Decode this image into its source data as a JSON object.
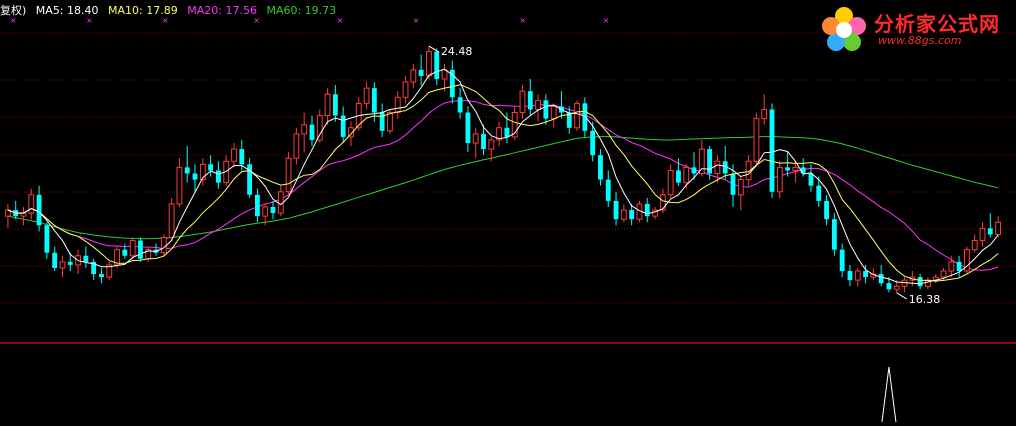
{
  "legend": {
    "prefix": "复权)",
    "ma5": "MA5: 18.40",
    "ma10": "MA10: 17.89",
    "ma20": "MA20: 17.56",
    "ma60": "MA60: 19.73"
  },
  "logo": {
    "title": "分析家公式网",
    "url": "www.88gs.com"
  },
  "colors": {
    "background": "#000000",
    "up": "#ff3b3b",
    "down": "#00ffff",
    "ma5": "#ffffff",
    "ma10": "#ffff66",
    "ma20": "#ff33ff",
    "ma60": "#33cc33",
    "grid": "#8b0000",
    "separator": "#ff2020"
  },
  "chart_data": {
    "type": "candlestick",
    "title": "",
    "price_axis": {
      "min": 15.0,
      "max": 25.5
    },
    "annotations": [
      {
        "label": "24.48",
        "type": "high",
        "index": 54
      },
      {
        "label": "16.38",
        "type": "low",
        "index": 114
      }
    ],
    "candles": [
      [
        18.9,
        19.3,
        18.5,
        19.1
      ],
      [
        19.1,
        19.4,
        18.8,
        18.9
      ],
      [
        18.9,
        19.2,
        18.6,
        19.0
      ],
      [
        19.0,
        19.8,
        18.8,
        19.6
      ],
      [
        19.6,
        19.9,
        18.4,
        18.6
      ],
      [
        18.6,
        18.7,
        17.5,
        17.7
      ],
      [
        17.7,
        17.9,
        17.1,
        17.2
      ],
      [
        17.2,
        17.6,
        16.9,
        17.4
      ],
      [
        17.4,
        17.7,
        17.1,
        17.3
      ],
      [
        17.3,
        17.8,
        17.0,
        17.6
      ],
      [
        17.6,
        17.9,
        17.2,
        17.4
      ],
      [
        17.4,
        17.5,
        16.8,
        17.0
      ],
      [
        17.0,
        17.2,
        16.7,
        16.9
      ],
      [
        16.9,
        17.4,
        16.8,
        17.3
      ],
      [
        17.3,
        17.9,
        17.2,
        17.8
      ],
      [
        17.8,
        18.0,
        17.5,
        17.6
      ],
      [
        17.6,
        18.2,
        17.5,
        18.1
      ],
      [
        18.1,
        18.2,
        17.4,
        17.5
      ],
      [
        17.5,
        17.9,
        17.4,
        17.8
      ],
      [
        17.8,
        18.0,
        17.6,
        17.7
      ],
      [
        17.7,
        18.3,
        17.6,
        18.2
      ],
      [
        18.2,
        19.5,
        18.1,
        19.3
      ],
      [
        19.3,
        20.8,
        19.2,
        20.5
      ],
      [
        20.5,
        21.2,
        20.0,
        20.3
      ],
      [
        20.3,
        20.6,
        19.7,
        20.1
      ],
      [
        20.1,
        20.8,
        19.9,
        20.6
      ],
      [
        20.6,
        20.9,
        20.2,
        20.4
      ],
      [
        20.4,
        20.7,
        19.8,
        20.0
      ],
      [
        20.0,
        20.9,
        19.9,
        20.7
      ],
      [
        20.7,
        21.3,
        20.5,
        21.1
      ],
      [
        21.1,
        21.4,
        20.4,
        20.6
      ],
      [
        20.6,
        20.8,
        19.5,
        19.6
      ],
      [
        19.6,
        19.8,
        18.7,
        18.9
      ],
      [
        18.9,
        19.3,
        18.6,
        19.2
      ],
      [
        19.2,
        19.4,
        18.8,
        19.0
      ],
      [
        19.0,
        19.9,
        18.9,
        19.7
      ],
      [
        19.7,
        21.0,
        19.6,
        20.8
      ],
      [
        20.8,
        21.8,
        20.6,
        21.6
      ],
      [
        21.6,
        22.3,
        21.0,
        21.9
      ],
      [
        21.9,
        22.2,
        21.2,
        21.4
      ],
      [
        21.4,
        22.4,
        21.3,
        22.2
      ],
      [
        22.2,
        23.1,
        21.9,
        22.9
      ],
      [
        22.9,
        23.2,
        22.0,
        22.2
      ],
      [
        22.2,
        22.5,
        21.3,
        21.5
      ],
      [
        21.5,
        22.0,
        21.2,
        21.8
      ],
      [
        21.8,
        22.8,
        21.7,
        22.6
      ],
      [
        22.6,
        23.3,
        22.4,
        23.1
      ],
      [
        23.1,
        23.3,
        22.0,
        22.3
      ],
      [
        22.3,
        22.6,
        21.5,
        21.7
      ],
      [
        21.7,
        22.4,
        21.6,
        22.3
      ],
      [
        22.3,
        23.0,
        22.1,
        22.8
      ],
      [
        22.8,
        23.5,
        22.6,
        23.3
      ],
      [
        23.3,
        23.9,
        23.1,
        23.7
      ],
      [
        23.7,
        24.2,
        23.2,
        23.5
      ],
      [
        23.5,
        24.48,
        23.4,
        24.3
      ],
      [
        24.3,
        24.4,
        23.2,
        23.4
      ],
      [
        23.4,
        23.9,
        23.0,
        23.7
      ],
      [
        23.7,
        24.0,
        22.6,
        22.8
      ],
      [
        22.8,
        23.1,
        22.1,
        22.3
      ],
      [
        22.3,
        22.5,
        21.0,
        21.3
      ],
      [
        21.3,
        21.8,
        20.8,
        21.6
      ],
      [
        21.6,
        21.9,
        20.9,
        21.1
      ],
      [
        21.1,
        21.5,
        20.7,
        21.4
      ],
      [
        21.4,
        22.0,
        21.2,
        21.8
      ],
      [
        21.8,
        22.3,
        21.3,
        21.5
      ],
      [
        21.5,
        22.5,
        21.4,
        22.3
      ],
      [
        22.3,
        23.2,
        22.1,
        23.0
      ],
      [
        23.0,
        23.4,
        22.2,
        22.4
      ],
      [
        22.4,
        22.9,
        22.0,
        22.7
      ],
      [
        22.7,
        22.9,
        21.9,
        22.1
      ],
      [
        22.1,
        22.6,
        21.8,
        22.5
      ],
      [
        22.5,
        23.0,
        22.1,
        22.3
      ],
      [
        22.3,
        22.5,
        21.6,
        21.8
      ],
      [
        21.8,
        22.7,
        21.7,
        22.6
      ],
      [
        22.6,
        22.8,
        21.5,
        21.7
      ],
      [
        21.7,
        22.0,
        20.7,
        20.9
      ],
      [
        20.9,
        21.1,
        19.9,
        20.1
      ],
      [
        20.1,
        20.4,
        19.2,
        19.4
      ],
      [
        19.4,
        19.7,
        18.6,
        18.8
      ],
      [
        18.8,
        19.3,
        18.7,
        19.1
      ],
      [
        19.1,
        19.3,
        18.6,
        18.8
      ],
      [
        18.8,
        19.4,
        18.7,
        19.3
      ],
      [
        19.3,
        19.5,
        18.7,
        18.9
      ],
      [
        18.9,
        19.2,
        18.8,
        19.1
      ],
      [
        19.1,
        19.8,
        19.0,
        19.6
      ],
      [
        19.6,
        20.6,
        19.5,
        20.4
      ],
      [
        20.4,
        20.8,
        19.9,
        20.0
      ],
      [
        20.0,
        20.6,
        19.8,
        20.5
      ],
      [
        20.5,
        21.0,
        20.1,
        20.3
      ],
      [
        20.3,
        21.4,
        20.2,
        21.1
      ],
      [
        21.1,
        21.2,
        20.1,
        20.3
      ],
      [
        20.3,
        20.9,
        20.0,
        20.7
      ],
      [
        20.7,
        21.2,
        20.1,
        20.3
      ],
      [
        20.3,
        20.6,
        19.2,
        19.6
      ],
      [
        19.6,
        20.2,
        19.1,
        20.1
      ],
      [
        20.1,
        20.9,
        19.9,
        20.7
      ],
      [
        20.7,
        22.3,
        20.6,
        22.1
      ],
      [
        22.1,
        22.9,
        21.9,
        22.4
      ],
      [
        22.4,
        22.6,
        19.5,
        19.7
      ],
      [
        19.7,
        20.7,
        19.5,
        20.5
      ],
      [
        20.5,
        21.0,
        20.2,
        20.4
      ],
      [
        20.4,
        20.7,
        20.0,
        20.5
      ],
      [
        20.5,
        20.8,
        20.2,
        20.3
      ],
      [
        20.3,
        20.6,
        19.7,
        19.9
      ],
      [
        19.9,
        20.2,
        19.2,
        19.4
      ],
      [
        19.4,
        19.6,
        18.6,
        18.8
      ],
      [
        18.8,
        19.0,
        17.6,
        17.8
      ],
      [
        17.8,
        18.0,
        16.9,
        17.1
      ],
      [
        17.1,
        17.3,
        16.6,
        16.8
      ],
      [
        16.8,
        17.2,
        16.6,
        17.1
      ],
      [
        17.1,
        17.3,
        16.7,
        16.9
      ],
      [
        16.9,
        17.2,
        16.8,
        17.0
      ],
      [
        17.0,
        17.3,
        16.6,
        16.7
      ],
      [
        16.7,
        16.9,
        16.4,
        16.5
      ],
      [
        16.5,
        16.8,
        16.38,
        16.6
      ],
      [
        16.6,
        16.9,
        16.4,
        16.8
      ],
      [
        16.8,
        17.1,
        16.6,
        16.9
      ],
      [
        16.9,
        17.0,
        16.5,
        16.6
      ],
      [
        16.6,
        16.9,
        16.5,
        16.8
      ],
      [
        16.8,
        17.0,
        16.7,
        16.9
      ],
      [
        16.9,
        17.2,
        16.8,
        17.1
      ],
      [
        17.1,
        17.6,
        16.9,
        17.4
      ],
      [
        17.4,
        17.6,
        16.9,
        17.1
      ],
      [
        17.1,
        17.9,
        17.0,
        17.8
      ],
      [
        17.8,
        18.3,
        17.7,
        18.1
      ],
      [
        18.1,
        18.7,
        17.9,
        18.5
      ],
      [
        18.5,
        19.0,
        18.2,
        18.3
      ],
      [
        18.3,
        18.9,
        18.2,
        18.7
      ]
    ],
    "ma60": [
      18.9,
      18.85,
      18.8,
      18.75,
      18.7,
      18.62,
      18.55,
      18.48,
      18.42,
      18.36,
      18.32,
      18.28,
      18.25,
      18.22,
      18.2,
      18.18,
      18.17,
      18.16,
      18.16,
      18.17,
      18.18,
      18.2,
      18.23,
      18.26,
      18.3,
      18.34,
      18.38,
      18.43,
      18.48,
      18.53,
      18.58,
      18.63,
      18.67,
      18.7,
      18.74,
      18.78,
      18.83,
      18.9,
      18.97,
      19.04,
      19.12,
      19.2,
      19.28,
      19.36,
      19.44,
      19.52,
      19.6,
      19.68,
      19.76,
      19.84,
      19.92,
      20.0,
      20.08,
      20.17,
      20.26,
      20.35,
      20.43,
      20.5,
      20.57,
      20.63,
      20.69,
      20.75,
      20.8,
      20.86,
      20.92,
      20.98,
      21.04,
      21.1,
      21.16,
      21.22,
      21.28,
      21.34,
      21.4,
      21.45,
      21.48,
      21.5,
      21.51,
      21.51,
      21.5,
      21.48,
      21.46,
      21.44,
      21.42,
      21.41,
      21.4,
      21.4,
      21.41,
      21.42,
      21.43,
      21.44,
      21.45,
      21.46,
      21.47,
      21.48,
      21.48,
      21.49,
      21.5,
      21.51,
      21.51,
      21.5,
      21.49,
      21.48,
      21.47,
      21.45,
      21.42,
      21.38,
      21.33,
      21.27,
      21.2,
      21.13,
      21.05,
      20.97,
      20.89,
      20.81,
      20.73,
      20.65,
      20.57,
      20.5,
      20.43,
      20.36,
      20.29,
      20.22,
      20.15,
      20.08,
      20.01,
      19.95,
      19.89,
      19.83
    ],
    "indicator": {
      "spike_index": 113,
      "spike_value": 1
    }
  }
}
